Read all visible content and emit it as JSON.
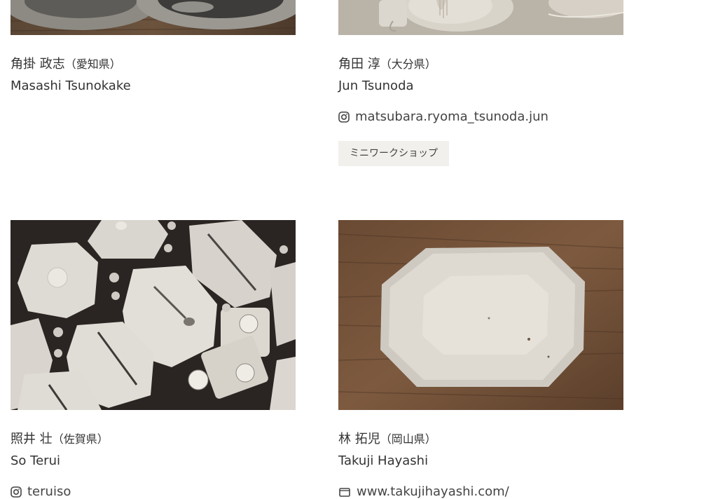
{
  "artists": [
    {
      "name_jp": "角掛 政志",
      "prefecture": "（愛知県）",
      "name_en": "Masashi Tsunokake",
      "link": "",
      "link_icon": "",
      "tag": ""
    },
    {
      "name_jp": "角田 淳",
      "prefecture": "（大分県）",
      "name_en": "Jun Tsunoda",
      "link": "matsubara.ryoma_tsunoda.jun",
      "link_icon": "instagram-icon",
      "tag": "ミニワークショップ"
    },
    {
      "name_jp": "照井 壮",
      "prefecture": "（佐賀県）",
      "name_en": "So Terui",
      "link": "teruiso",
      "link_icon": "instagram-icon",
      "tag": ""
    },
    {
      "name_jp": "林 拓児",
      "prefecture": "（岡山県）",
      "name_en": "Takuji Hayashi",
      "link": "www.takujihayashi.com/",
      "link_icon": "web-icon",
      "tag": ""
    }
  ],
  "colors": {
    "text": "#333333",
    "tag_bg": "#f1f0ec"
  }
}
